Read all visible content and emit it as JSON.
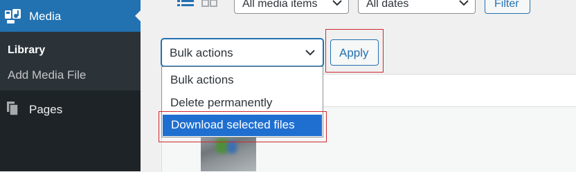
{
  "sidebar": {
    "media_label": "Media",
    "media_icon": "media-icon",
    "submenu": {
      "library_label": "Library",
      "add_media_label": "Add Media File"
    },
    "pages_label": "Pages",
    "pages_icon": "pages-icon"
  },
  "toolbar": {
    "view_list_icon": "list-view-icon",
    "view_grid_icon": "grid-view-icon",
    "media_type_select": "All media items",
    "date_select": "All dates",
    "filter_label": "Filter"
  },
  "bulk_actions": {
    "selected_value": "Bulk actions",
    "apply_label": "Apply",
    "options": [
      "Bulk actions",
      "Delete permanently",
      "Download selected files"
    ],
    "highlighted_option_index": 2
  },
  "colors": {
    "sidebar_bg": "#1d2327",
    "media_active_bg": "#2271b1",
    "accent": "#2271b1",
    "highlight_option": "#1f6fd0",
    "annotation_red": "#d0272c"
  }
}
